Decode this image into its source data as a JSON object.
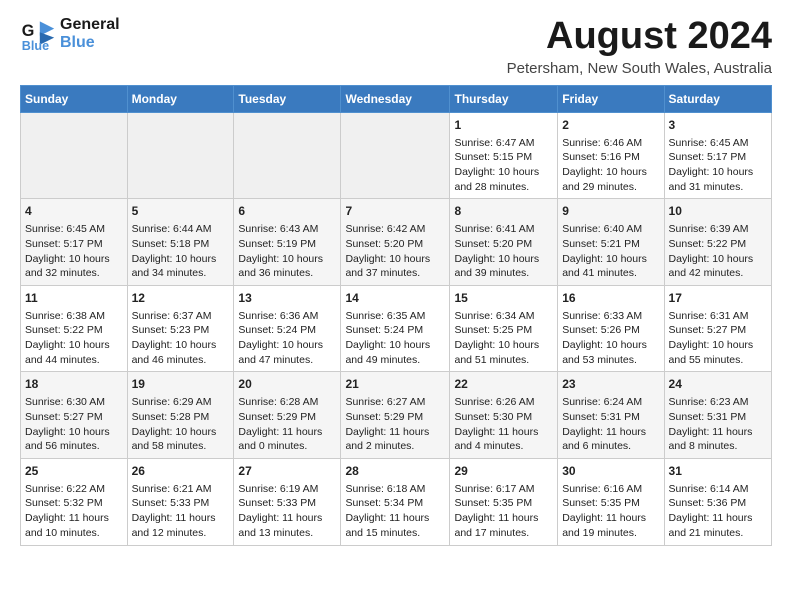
{
  "logo": {
    "line1": "General",
    "line2": "Blue"
  },
  "title": "August 2024",
  "location": "Petersham, New South Wales, Australia",
  "weekdays": [
    "Sunday",
    "Monday",
    "Tuesday",
    "Wednesday",
    "Thursday",
    "Friday",
    "Saturday"
  ],
  "weeks": [
    [
      {
        "day": "",
        "info": ""
      },
      {
        "day": "",
        "info": ""
      },
      {
        "day": "",
        "info": ""
      },
      {
        "day": "",
        "info": ""
      },
      {
        "day": "1",
        "info": "Sunrise: 6:47 AM\nSunset: 5:15 PM\nDaylight: 10 hours and 28 minutes."
      },
      {
        "day": "2",
        "info": "Sunrise: 6:46 AM\nSunset: 5:16 PM\nDaylight: 10 hours and 29 minutes."
      },
      {
        "day": "3",
        "info": "Sunrise: 6:45 AM\nSunset: 5:17 PM\nDaylight: 10 hours and 31 minutes."
      }
    ],
    [
      {
        "day": "4",
        "info": "Sunrise: 6:45 AM\nSunset: 5:17 PM\nDaylight: 10 hours and 32 minutes."
      },
      {
        "day": "5",
        "info": "Sunrise: 6:44 AM\nSunset: 5:18 PM\nDaylight: 10 hours and 34 minutes."
      },
      {
        "day": "6",
        "info": "Sunrise: 6:43 AM\nSunset: 5:19 PM\nDaylight: 10 hours and 36 minutes."
      },
      {
        "day": "7",
        "info": "Sunrise: 6:42 AM\nSunset: 5:20 PM\nDaylight: 10 hours and 37 minutes."
      },
      {
        "day": "8",
        "info": "Sunrise: 6:41 AM\nSunset: 5:20 PM\nDaylight: 10 hours and 39 minutes."
      },
      {
        "day": "9",
        "info": "Sunrise: 6:40 AM\nSunset: 5:21 PM\nDaylight: 10 hours and 41 minutes."
      },
      {
        "day": "10",
        "info": "Sunrise: 6:39 AM\nSunset: 5:22 PM\nDaylight: 10 hours and 42 minutes."
      }
    ],
    [
      {
        "day": "11",
        "info": "Sunrise: 6:38 AM\nSunset: 5:22 PM\nDaylight: 10 hours and 44 minutes."
      },
      {
        "day": "12",
        "info": "Sunrise: 6:37 AM\nSunset: 5:23 PM\nDaylight: 10 hours and 46 minutes."
      },
      {
        "day": "13",
        "info": "Sunrise: 6:36 AM\nSunset: 5:24 PM\nDaylight: 10 hours and 47 minutes."
      },
      {
        "day": "14",
        "info": "Sunrise: 6:35 AM\nSunset: 5:24 PM\nDaylight: 10 hours and 49 minutes."
      },
      {
        "day": "15",
        "info": "Sunrise: 6:34 AM\nSunset: 5:25 PM\nDaylight: 10 hours and 51 minutes."
      },
      {
        "day": "16",
        "info": "Sunrise: 6:33 AM\nSunset: 5:26 PM\nDaylight: 10 hours and 53 minutes."
      },
      {
        "day": "17",
        "info": "Sunrise: 6:31 AM\nSunset: 5:27 PM\nDaylight: 10 hours and 55 minutes."
      }
    ],
    [
      {
        "day": "18",
        "info": "Sunrise: 6:30 AM\nSunset: 5:27 PM\nDaylight: 10 hours and 56 minutes."
      },
      {
        "day": "19",
        "info": "Sunrise: 6:29 AM\nSunset: 5:28 PM\nDaylight: 10 hours and 58 minutes."
      },
      {
        "day": "20",
        "info": "Sunrise: 6:28 AM\nSunset: 5:29 PM\nDaylight: 11 hours and 0 minutes."
      },
      {
        "day": "21",
        "info": "Sunrise: 6:27 AM\nSunset: 5:29 PM\nDaylight: 11 hours and 2 minutes."
      },
      {
        "day": "22",
        "info": "Sunrise: 6:26 AM\nSunset: 5:30 PM\nDaylight: 11 hours and 4 minutes."
      },
      {
        "day": "23",
        "info": "Sunrise: 6:24 AM\nSunset: 5:31 PM\nDaylight: 11 hours and 6 minutes."
      },
      {
        "day": "24",
        "info": "Sunrise: 6:23 AM\nSunset: 5:31 PM\nDaylight: 11 hours and 8 minutes."
      }
    ],
    [
      {
        "day": "25",
        "info": "Sunrise: 6:22 AM\nSunset: 5:32 PM\nDaylight: 11 hours and 10 minutes."
      },
      {
        "day": "26",
        "info": "Sunrise: 6:21 AM\nSunset: 5:33 PM\nDaylight: 11 hours and 12 minutes."
      },
      {
        "day": "27",
        "info": "Sunrise: 6:19 AM\nSunset: 5:33 PM\nDaylight: 11 hours and 13 minutes."
      },
      {
        "day": "28",
        "info": "Sunrise: 6:18 AM\nSunset: 5:34 PM\nDaylight: 11 hours and 15 minutes."
      },
      {
        "day": "29",
        "info": "Sunrise: 6:17 AM\nSunset: 5:35 PM\nDaylight: 11 hours and 17 minutes."
      },
      {
        "day": "30",
        "info": "Sunrise: 6:16 AM\nSunset: 5:35 PM\nDaylight: 11 hours and 19 minutes."
      },
      {
        "day": "31",
        "info": "Sunrise: 6:14 AM\nSunset: 5:36 PM\nDaylight: 11 hours and 21 minutes."
      }
    ]
  ]
}
